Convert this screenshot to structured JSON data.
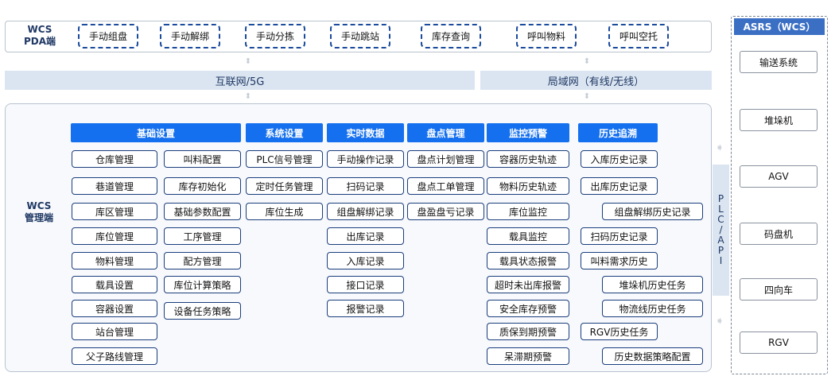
{
  "pda": {
    "label": "WCS\nPDA端",
    "buttons": [
      "手动组盘",
      "手动解绑",
      "手动分拣",
      "手动跳站",
      "库存查询",
      "呼叫物料",
      "呼叫空托"
    ]
  },
  "network": {
    "internet": "互联网/5G",
    "lan": "局域网（有线/无线）"
  },
  "mgmt": {
    "label": "WCS\n管理端",
    "headers": [
      "基础设置",
      "系统设置",
      "实时数据",
      "盘点管理",
      "监控预警",
      "历史追溯"
    ],
    "basic_col1": [
      "仓库管理",
      "巷道管理",
      "库区管理",
      "库位管理",
      "物料管理",
      "载具设置",
      "容器设置",
      "站台管理",
      "父子路线管理"
    ],
    "basic_col2": [
      "叫料配置",
      "库存初始化",
      "基础参数配置",
      "工序管理",
      "配方管理",
      "库位计算策略",
      "设备任务策略"
    ],
    "system": [
      "PLC信号管理",
      "定时任务管理",
      "库位生成"
    ],
    "realtime": [
      "手动操作记录",
      "扫码记录",
      "组盘解绑记录",
      "出库记录",
      "入库记录",
      "接口记录",
      "报警记录"
    ],
    "inventory": [
      "盘点计划管理",
      "盘点工单管理",
      "盘盈盘亏记录"
    ],
    "monitor": [
      "容器历史轨迹",
      "物料历史轨迹",
      "库位监控",
      "载具监控",
      "载具状态报警",
      "超时未出库报警",
      "安全库存预警",
      "质保到期预警",
      "呆滞期预警"
    ],
    "history": [
      "入库历史记录",
      "出库历史记录",
      "组盘解绑历史记录",
      "扫码历史记录",
      "叫料需求历史",
      "堆垛机历史任务",
      "物流线历史任务",
      "RGV历史任务",
      "历史数据策略配置"
    ]
  },
  "plc_api": "PLC/API",
  "asrs": {
    "title": "ASRS（WCS）",
    "items": [
      "输送系统",
      "堆垛机",
      "AGV",
      "码盘机",
      "四向车",
      "RGV"
    ]
  }
}
